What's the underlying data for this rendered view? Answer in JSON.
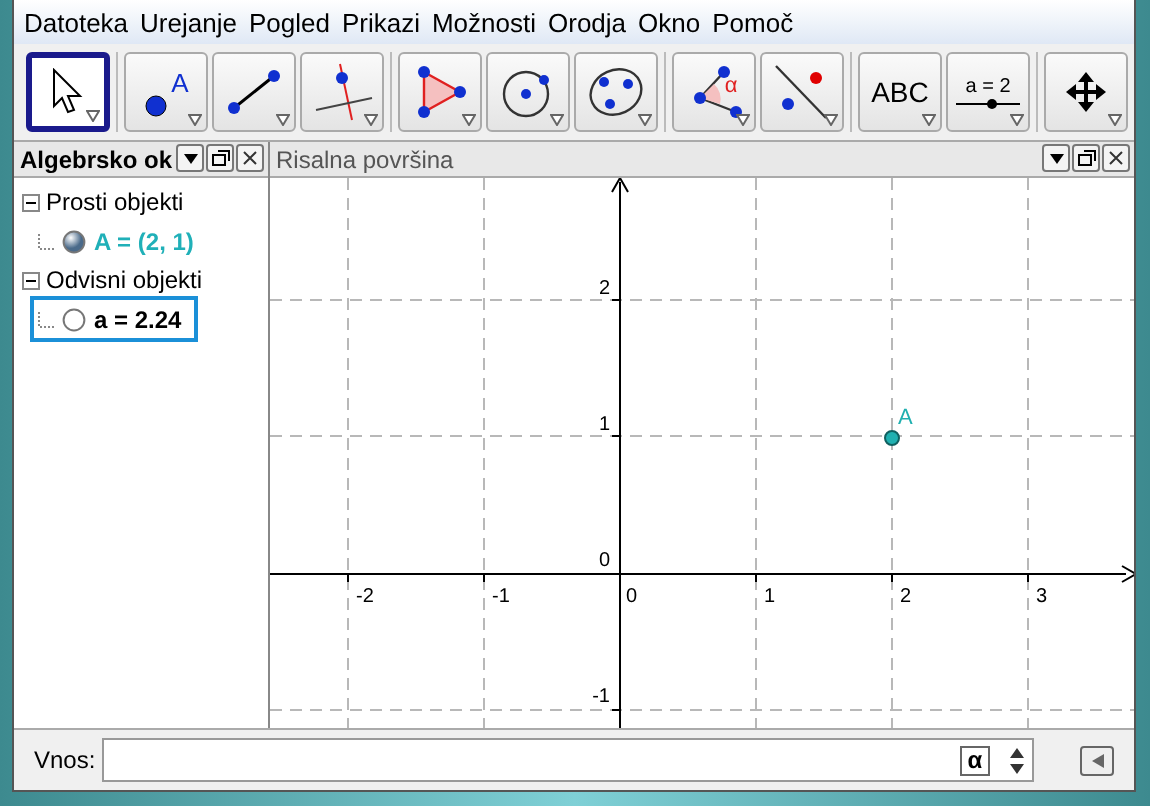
{
  "menu": [
    "Datoteka",
    "Urejanje",
    "Pogled",
    "Prikazi",
    "Možnosti",
    "Orodja",
    "Okno",
    "Pomoč"
  ],
  "toolbar": [
    {
      "kind": "select",
      "selected": true
    },
    {
      "kind": "point",
      "label": "A",
      "selected": false
    },
    {
      "kind": "segment",
      "selected": false
    },
    {
      "kind": "perpendicular",
      "selected": false
    },
    {
      "kind": "polygon",
      "selected": false
    },
    {
      "kind": "circle",
      "selected": false
    },
    {
      "kind": "conic",
      "selected": false
    },
    {
      "kind": "angle",
      "label": "α",
      "selected": false
    },
    {
      "kind": "reflect",
      "selected": false
    },
    {
      "kind": "text",
      "label": "ABC",
      "selected": false
    },
    {
      "kind": "slider",
      "label": "a = 2",
      "selected": false
    },
    {
      "kind": "move",
      "selected": false
    }
  ],
  "algebra": {
    "title": "Algebrsko ok",
    "groups": [
      {
        "name": "Prosti objekti",
        "expanded": true,
        "children": [
          {
            "text": "A = (2, 1)",
            "shown": true,
            "selected": false
          }
        ]
      },
      {
        "name": "Odvisni objekti",
        "expanded": true,
        "children": [
          {
            "text": "a = 2.24",
            "shown": false,
            "selected": true
          }
        ]
      }
    ]
  },
  "graphics": {
    "title": "Risalna površina",
    "x_labels": [
      "-2",
      "-1",
      "0",
      "1",
      "2",
      "3"
    ],
    "y_labels": [
      "2",
      "1",
      "0",
      "-1"
    ],
    "point": {
      "label": "A"
    }
  },
  "input": {
    "label": "Vnos:",
    "symbol": "α"
  }
}
